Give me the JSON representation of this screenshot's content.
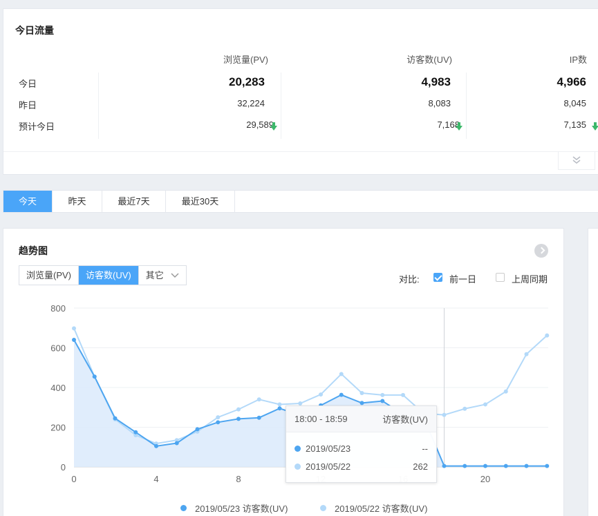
{
  "traffic": {
    "title": "今日流量",
    "headers": [
      "浏览量(PV)",
      "访客数(UV)",
      "IP数"
    ],
    "rows": [
      {
        "label": "今日",
        "values": [
          "20,283",
          "4,983",
          "4,966"
        ]
      },
      {
        "label": "昨日",
        "values": [
          "32,224",
          "8,083",
          "8,045"
        ]
      },
      {
        "label": "预计今日",
        "values": [
          "29,589",
          "7,168",
          "7,135"
        ]
      }
    ]
  },
  "tabs": [
    "今天",
    "昨天",
    "最近7天",
    "最近30天"
  ],
  "trend": {
    "title": "趋势图",
    "metrics": [
      "浏览量(PV)",
      "访客数(UV)",
      "其它"
    ],
    "compare_label": "对比:",
    "compare_options": [
      "前一日",
      "上周同期"
    ]
  },
  "tooltip": {
    "time": "18:00 - 18:59",
    "metric": "访客数(UV)",
    "rows": [
      {
        "date": "2019/05/23",
        "value": "--"
      },
      {
        "date": "2019/05/22",
        "value": "262"
      }
    ]
  },
  "colors": {
    "accent": "#4aa5f8",
    "series_today": "#4da5f0",
    "series_prev": "#b3d9f9",
    "down_arrow": "#3cb86a"
  },
  "chart_data": {
    "type": "line",
    "x": [
      0,
      1,
      2,
      3,
      4,
      5,
      6,
      7,
      8,
      9,
      10,
      11,
      12,
      13,
      14,
      15,
      16,
      17,
      18,
      19,
      20,
      21,
      22,
      23
    ],
    "xticks": [
      "0",
      "4",
      "8",
      "12",
      "16",
      "20"
    ],
    "yticks": [
      "0",
      "200",
      "400",
      "600",
      "800"
    ],
    "ylim": [
      0,
      800
    ],
    "grid": true,
    "legend": "bottom",
    "series": [
      {
        "name": "2019/05/23 访客数(UV)",
        "values": [
          640,
          455,
          245,
          175,
          105,
          120,
          190,
          225,
          242,
          248,
          295,
          260,
          310,
          363,
          322,
          332,
          265,
          250,
          5,
          5,
          5,
          5,
          5,
          5
        ]
      },
      {
        "name": "2019/05/22 访客数(UV)",
        "values": [
          698,
          455,
          240,
          160,
          118,
          135,
          178,
          250,
          290,
          340,
          315,
          320,
          365,
          468,
          372,
          362,
          362,
          270,
          262,
          293,
          315,
          380,
          568,
          662
        ]
      }
    ]
  }
}
